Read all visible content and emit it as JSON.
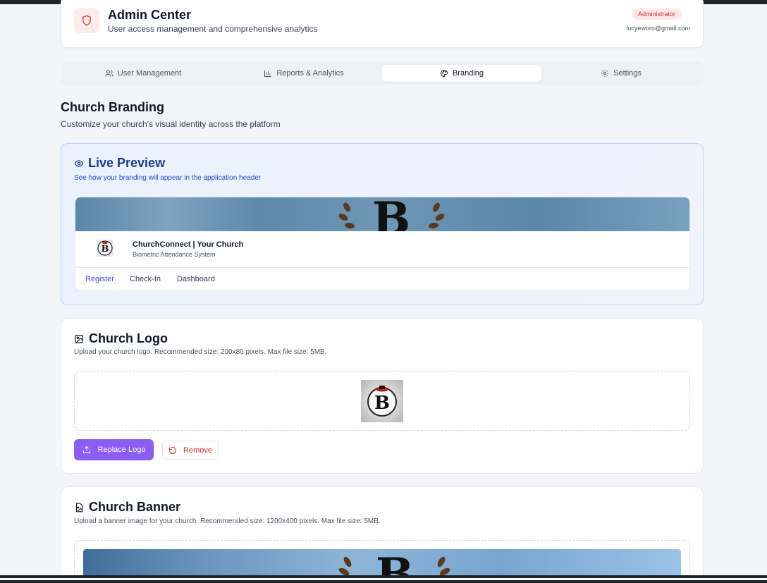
{
  "header": {
    "title": "Admin Center",
    "subtitle": "User access management and comprehensive analytics",
    "role_badge": "Administrator",
    "email": "lucyeworo@gmail.com"
  },
  "tabs": [
    {
      "label": "User Management",
      "icon": "users-icon",
      "active": false
    },
    {
      "label": "Reports & Analytics",
      "icon": "bar-chart-icon",
      "active": false
    },
    {
      "label": "Branding",
      "icon": "palette-icon",
      "active": true
    },
    {
      "label": "Settings",
      "icon": "gear-icon",
      "active": false
    }
  ],
  "section": {
    "title": "Church Branding",
    "subtitle": "Customize your church's visual identity across the platform"
  },
  "live_preview": {
    "title": "Live Preview",
    "subtitle": "See how your branding will appear in the application header",
    "app_name": "ChurchConnect | Your Church",
    "app_subtitle": "Biometric Attendance System",
    "nav": [
      "Register",
      "Check-In",
      "Dashboard"
    ],
    "active_nav": "Register"
  },
  "logo_card": {
    "title": "Church Logo",
    "subtitle": "Upload your church logo. Recommended size: 200x80 pixels. Max file size: 5MB.",
    "replace_label": "Replace Logo",
    "remove_label": "Remove"
  },
  "banner_card": {
    "title": "Church Banner",
    "subtitle": "Upload a banner image for your church. Recommended size: 1200x400 pixels. Max file size: 5MB."
  },
  "colors": {
    "accent": "#8b5cf6",
    "danger": "#dc2626",
    "preview_title": "#1e3a8a",
    "nav_active": "#4f46e5"
  }
}
